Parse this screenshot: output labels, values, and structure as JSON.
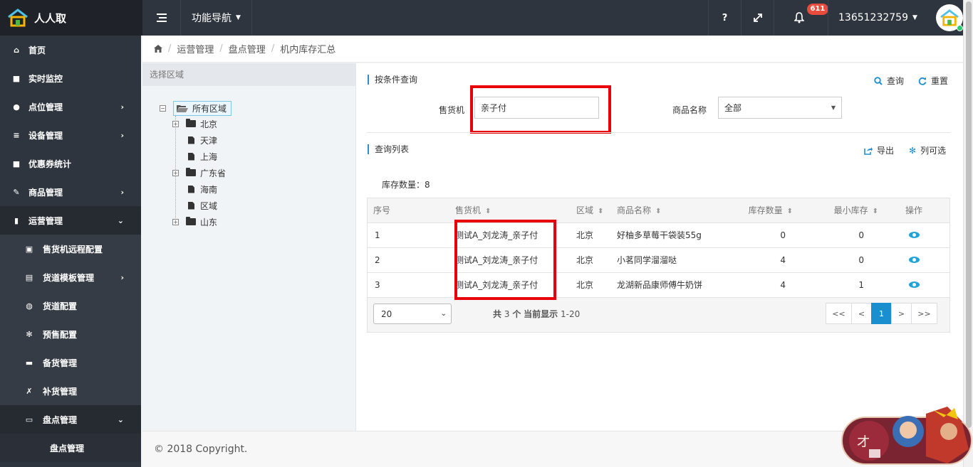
{
  "brand": {
    "name": "人人取"
  },
  "topbar": {
    "nav_label": "功能导航",
    "help": "?",
    "notification_count": "611",
    "username": "13651232759"
  },
  "sidebar": {
    "items": [
      {
        "label": "首页",
        "icon": "home-icon"
      },
      {
        "label": "实时监控",
        "icon": "video-camera-icon"
      },
      {
        "label": "点位管理",
        "icon": "map-marker-icon"
      },
      {
        "label": "设备管理",
        "icon": "sort-list-icon"
      },
      {
        "label": "优惠券统计",
        "icon": "square-icon"
      },
      {
        "label": "商品管理",
        "icon": "edit-icon"
      },
      {
        "label": "运营管理",
        "icon": "bookmark-icon"
      }
    ],
    "sub_items": [
      {
        "label": "售货机远程配置",
        "icon": "remote-config-icon"
      },
      {
        "label": "货道模板管理",
        "icon": "file-icon"
      },
      {
        "label": "货道配置",
        "icon": "globe-icon"
      },
      {
        "label": "预售配置",
        "icon": "gear-icon"
      },
      {
        "label": "备货管理",
        "icon": "archive-icon"
      },
      {
        "label": "补货管理",
        "icon": "wrench-icon"
      },
      {
        "label": "盘点管理",
        "icon": "money-icon"
      }
    ],
    "subsub_items": [
      {
        "label": "盘点管理"
      }
    ]
  },
  "breadcrumb": [
    "运营管理",
    "盘点管理",
    "机内库存汇总"
  ],
  "tree": {
    "title": "选择区域",
    "root": "所有区域",
    "nodes": [
      "北京",
      "天津",
      "上海",
      "广东省",
      "海南",
      "区域",
      "山东"
    ]
  },
  "query": {
    "title": "按条件查询",
    "search_label": "查询",
    "reset_label": "重置",
    "machine_label": "售货机",
    "machine_value": "亲子付",
    "product_label": "商品名称",
    "product_value": "全部"
  },
  "list": {
    "title": "查询列表",
    "export_label": "导出",
    "columns_label": "列可选",
    "count_text": "库存数量：8",
    "headers": [
      "序号",
      "售货机",
      "区域",
      "商品名称",
      "库存数量",
      "最小库存",
      "操作"
    ],
    "rows": [
      {
        "no": "1",
        "machine": "测试A_刘龙涛_亲子付",
        "region": "北京",
        "product": "好柚多草莓干袋装55g",
        "stock": "0",
        "min_stock": "0"
      },
      {
        "no": "2",
        "machine": "测试A_刘龙涛_亲子付",
        "region": "北京",
        "product": "小茗同学溜溜哒",
        "stock": "4",
        "min_stock": "0"
      },
      {
        "no": "3",
        "machine": "测试A_刘龙涛_亲子付",
        "region": "北京",
        "product": "龙湖新品康师傅牛奶饼",
        "stock": "4",
        "min_stock": "1"
      }
    ],
    "page_size": "20",
    "page_info_prefix": "共",
    "page_info_total": "3",
    "page_info_unit": "个",
    "page_info_mid": "当前显示",
    "page_info_range": "1-20",
    "pager": {
      "first": "<<",
      "prev": "<",
      "current": "1",
      "next": ">",
      "last": ">>"
    }
  },
  "footer": {
    "copyright": "© 2018 Copyright."
  },
  "colors": {
    "accent": "#1a8fcf",
    "highlight": "#e8000b",
    "sidebar": "#2f353e",
    "badge": "#e74c3c"
  }
}
